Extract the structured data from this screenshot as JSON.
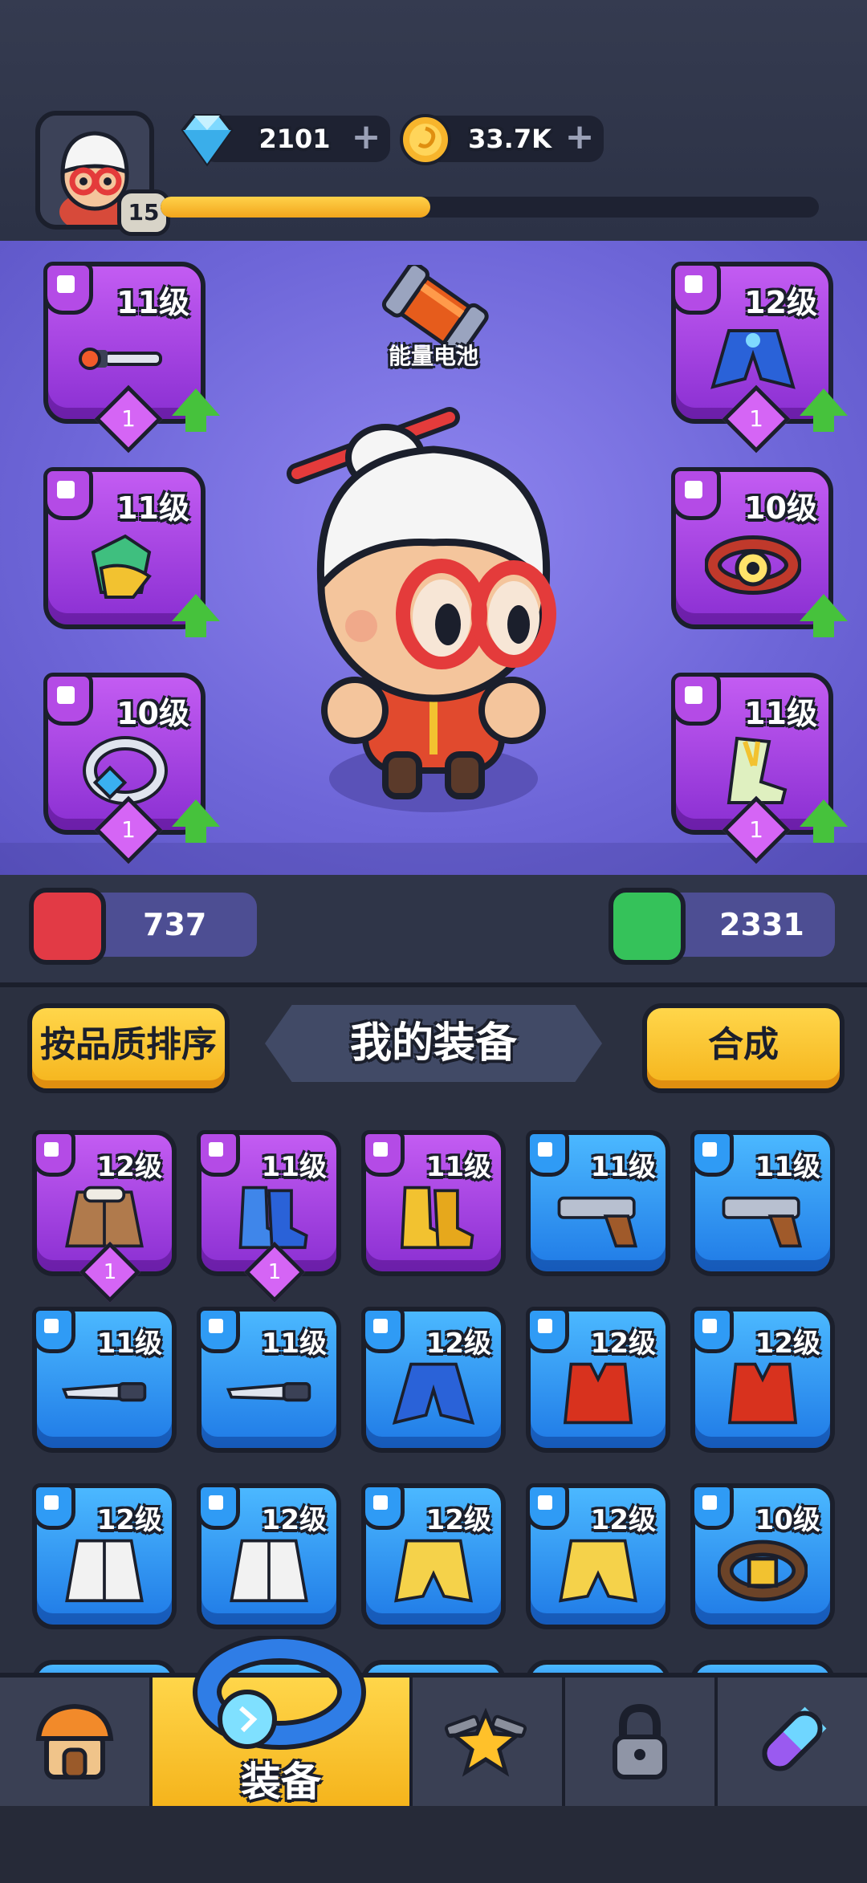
{
  "currency": {
    "gems": "2101",
    "coins": "33.7K"
  },
  "player": {
    "level": "15",
    "xp_fraction": 0.41
  },
  "featured_item": {
    "label": "能量电池"
  },
  "hero_slots": [
    {
      "slot": "weapon",
      "level": "11级",
      "count": "1",
      "upgradable": true
    },
    {
      "slot": "gloves",
      "level": "11级",
      "count": null,
      "upgradable": true
    },
    {
      "slot": "ring",
      "level": "10级",
      "count": "1",
      "upgradable": true
    },
    {
      "slot": "armor",
      "level": "12级",
      "count": "1",
      "upgradable": true
    },
    {
      "slot": "belt",
      "level": "10级",
      "count": null,
      "upgradable": true
    },
    {
      "slot": "boots",
      "level": "11级",
      "count": "1",
      "upgradable": true
    }
  ],
  "stats": {
    "attack": "737",
    "health": "2331"
  },
  "inventory": {
    "sort_button": "按品质排序",
    "title": "我的装备",
    "merge_button": "合成",
    "items": [
      {
        "level": "12级",
        "rarity": "purple",
        "type": "armor",
        "count": "1",
        "item": "jacket-icon"
      },
      {
        "level": "11级",
        "rarity": "purple",
        "type": "boots",
        "count": "1",
        "item": "blue-boots-icon"
      },
      {
        "level": "11级",
        "rarity": "purple",
        "type": "boots",
        "count": null,
        "item": "gold-boots-icon"
      },
      {
        "level": "11级",
        "rarity": "blue",
        "type": "weapon",
        "count": null,
        "item": "pistol-icon"
      },
      {
        "level": "11级",
        "rarity": "blue",
        "type": "weapon",
        "count": null,
        "item": "pistol-icon"
      },
      {
        "level": "11级",
        "rarity": "blue",
        "type": "weapon",
        "count": null,
        "item": "knife-icon"
      },
      {
        "level": "11级",
        "rarity": "blue",
        "type": "weapon",
        "count": null,
        "item": "knife-icon"
      },
      {
        "level": "12级",
        "rarity": "blue",
        "type": "armor",
        "count": null,
        "item": "blue-coat-icon"
      },
      {
        "level": "12级",
        "rarity": "blue",
        "type": "armor",
        "count": null,
        "item": "red-vest-icon"
      },
      {
        "level": "12级",
        "rarity": "blue",
        "type": "armor",
        "count": null,
        "item": "red-vest-icon"
      },
      {
        "level": "12级",
        "rarity": "blue",
        "type": "armor",
        "count": null,
        "item": "white-coat-icon"
      },
      {
        "level": "12级",
        "rarity": "blue",
        "type": "armor",
        "count": null,
        "item": "white-coat-icon"
      },
      {
        "level": "12级",
        "rarity": "blue",
        "type": "armor",
        "count": null,
        "item": "yellow-coat-icon"
      },
      {
        "level": "12级",
        "rarity": "blue",
        "type": "armor",
        "count": null,
        "item": "yellow-coat-icon"
      },
      {
        "level": "10级",
        "rarity": "blue",
        "type": "ring",
        "count": null,
        "item": "belt-icon"
      }
    ]
  },
  "nav": [
    {
      "id": "shop",
      "label": "",
      "icon": "shop-icon",
      "active": false
    },
    {
      "id": "equipment",
      "label": "装备",
      "icon": "ring-icon",
      "active": true
    },
    {
      "id": "battle",
      "label": "",
      "icon": "crossed-guns-star-icon",
      "active": false
    },
    {
      "id": "locked",
      "label": "",
      "icon": "lock-icon",
      "active": false
    },
    {
      "id": "pills",
      "label": "",
      "icon": "capsule-icon",
      "active": false
    }
  ],
  "colors": {
    "purple": "#b44be6",
    "blue": "#2f9bf5",
    "accent": "#ffd64a",
    "upgrade": "#46c23c"
  }
}
